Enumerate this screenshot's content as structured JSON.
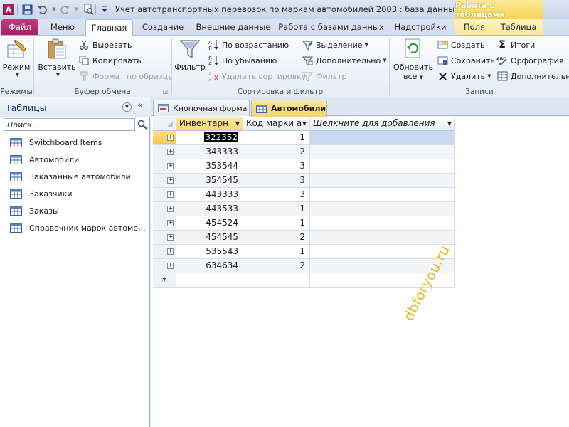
{
  "window": {
    "title": "Учет автотранспортных перевозок по маркам автомобилей 2003 : база данных (фо...",
    "context_tab_group": "Работа с таблицами"
  },
  "tabs": {
    "file": "Файл",
    "items": [
      "Меню",
      "Главная",
      "Создание",
      "Внешние данные",
      "Работа с базами данных",
      "Надстройки",
      "Поля",
      "Таблица"
    ],
    "active": "Главная"
  },
  "ribbon": {
    "groups": {
      "modes": "Режимы",
      "clipboard": "Буфер обмена",
      "sort_filter": "Сортировка и фильтр",
      "records": "Записи"
    },
    "view_button": "Режим",
    "paste_button": "Вставить",
    "cut": "Вырезать",
    "copy": "Копировать",
    "format_painter": "Формат по образцу",
    "filter_button": "Фильтр",
    "sort_asc": "По возрастанию",
    "sort_desc": "По убыванию",
    "remove_sort": "Удалить сортировку",
    "selection": "Выделение",
    "advanced": "Дополнительно",
    "toggle_filter": "Фильтр",
    "refresh_all_line1": "Обновить",
    "refresh_all_line2": "все",
    "new_record": "Создать",
    "save_record": "Сохранить",
    "delete_record": "Удалить",
    "totals": "Итоги",
    "spelling": "Орфография",
    "more": "Дополнительно"
  },
  "nav_pane": {
    "title": "Таблицы",
    "search_placeholder": "Поиск...",
    "items": [
      "Switchboard Items",
      "Автомобили",
      "Заказанные автомобили",
      "Заказчики",
      "Заказы",
      "Справочник марок автомо..."
    ]
  },
  "documents": {
    "tabs": [
      "Кнопочная форма",
      "Автомобили"
    ],
    "active": "Автомобили"
  },
  "datasheet": {
    "columns": [
      "Инвентарн",
      "Код марки а",
      "Щелкните для добавления"
    ],
    "rows": [
      {
        "inv": "322352",
        "code": "1"
      },
      {
        "inv": "343333",
        "code": "2"
      },
      {
        "inv": "353544",
        "code": "3"
      },
      {
        "inv": "354545",
        "code": "3"
      },
      {
        "inv": "443333",
        "code": "3"
      },
      {
        "inv": "443533",
        "code": "1"
      },
      {
        "inv": "454524",
        "code": "1"
      },
      {
        "inv": "454545",
        "code": "2"
      },
      {
        "inv": "535543",
        "code": "1"
      },
      {
        "inv": "634634",
        "code": "2"
      }
    ],
    "new_row_marker": "*"
  },
  "watermark": "dbforyou.ru",
  "colors": {
    "file_tab": "#b02a6d",
    "context_tab": "#f6d858",
    "selected_header": "#f8d66e",
    "watermark": "#e8b000"
  }
}
